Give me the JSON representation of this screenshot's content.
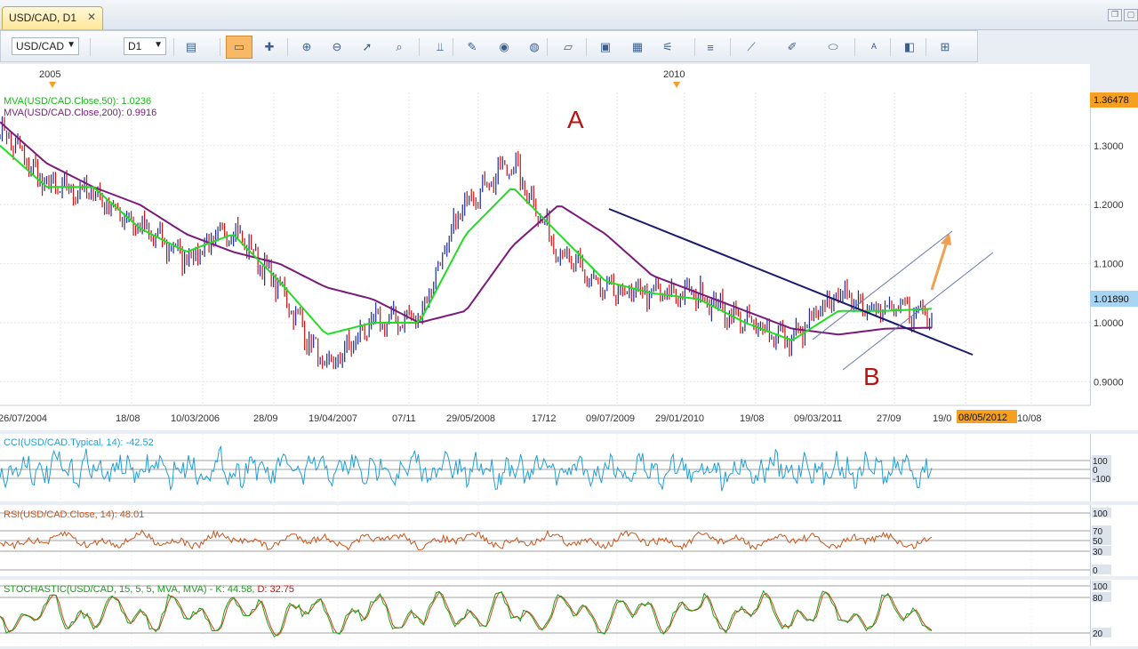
{
  "tab": {
    "title": "USD/CAD, D1",
    "close": "✕"
  },
  "toolbar": {
    "symbol": "USD/CAD",
    "timeframe": "D1",
    "icons": [
      "bar-chart-icon",
      "candle-chart-icon",
      "line-chart-icon",
      "crosshair-icon",
      "zoom-in-icon",
      "zoom-out-icon",
      "pointer-icon",
      "zoom-icon",
      "bar-price-icon",
      "edit-icon",
      "eye-icon",
      "globe-icon",
      "ruler-icon",
      "picture-icon",
      "template-icon",
      "indicators-icon",
      "lines-icon",
      "draw-line-icon",
      "pen-icon",
      "ellipse-icon",
      "text-icon",
      "eraser-icon",
      "structure-icon"
    ]
  },
  "top_axis": {
    "labels": [
      "2005",
      "2010"
    ]
  },
  "main": {
    "legend_ma50": "MVA(USD/CAD.Close,50): 1.0236",
    "legend_ma200": "MVA(USD/CAD.Close,200): 0.9916",
    "label_a": "A",
    "label_b": "B",
    "price_high": "1.36478",
    "price_current": "1.01890",
    "date_badge": "08/05/2012",
    "date_labels": [
      "26/07/2004",
      "18/08",
      "10/03/2006",
      "28/09",
      "19/04/2007",
      "07/11",
      "29/05/2008",
      "17/12",
      "09/07/2009",
      "29/01/2010",
      "19/08",
      "09/03/2011",
      "27/09",
      "19/0",
      "10/08"
    ]
  },
  "chart_data": [
    {
      "type": "line",
      "title": "USD/CAD, D1",
      "x": [
        "2004-07",
        "2005-01",
        "2005-07",
        "2006-01",
        "2006-07",
        "2007-01",
        "2007-07",
        "2007-11",
        "2008-01",
        "2008-07",
        "2008-10",
        "2009-03",
        "2009-07",
        "2009-10",
        "2010-01",
        "2010-07",
        "2011-01",
        "2011-07",
        "2011-10",
        "2012-01",
        "2012-05"
      ],
      "series": [
        {
          "name": "USD/CAD",
          "values": [
            1.33,
            1.23,
            1.22,
            1.16,
            1.11,
            1.16,
            1.06,
            0.92,
            1.0,
            1.01,
            1.21,
            1.27,
            1.12,
            1.05,
            1.05,
            1.05,
            1.0,
            0.97,
            1.05,
            1.02,
            1.02
          ]
        },
        {
          "name": "MVA(USD/CAD.Close,50)",
          "values": [
            1.3,
            1.23,
            1.23,
            1.16,
            1.12,
            1.15,
            1.07,
            0.98,
            1.0,
            1.0,
            1.15,
            1.23,
            1.15,
            1.07,
            1.05,
            1.04,
            1.0,
            0.97,
            1.02,
            1.02,
            1.0236
          ]
        },
        {
          "name": "MVA(USD/CAD.Close,200)",
          "values": [
            1.34,
            1.27,
            1.23,
            1.2,
            1.15,
            1.12,
            1.1,
            1.06,
            1.04,
            1.0,
            1.02,
            1.13,
            1.2,
            1.15,
            1.08,
            1.05,
            1.02,
            0.99,
            0.98,
            0.99,
            0.9916
          ]
        }
      ],
      "ylim": [
        0.86,
        1.39
      ],
      "yticks": [
        0.9,
        1.0,
        1.1,
        1.2,
        1.3
      ],
      "ytick_labels": [
        "0.9000",
        "1.0000",
        "1.1000",
        "1.2000",
        "1.3000"
      ],
      "annotations": [
        "A",
        "B"
      ],
      "grid": true
    },
    {
      "type": "line",
      "title": "CCI(USD/CAD.Typical, 14): -42.52",
      "series": [
        {
          "name": "CCI(USD/CAD.Typical, 14)",
          "last": -42.52
        }
      ],
      "levels": [
        "100",
        "0",
        "-100"
      ]
    },
    {
      "type": "line",
      "title": "RSI(USD/CAD.Close, 14): 48.01",
      "series": [
        {
          "name": "RSI(USD/CAD.Close, 14)",
          "last": 48.01
        }
      ],
      "levels": [
        "100",
        "70",
        "50",
        "30",
        "0"
      ]
    },
    {
      "type": "line",
      "title": "STOCHASTIC(USD/CAD, 15, 5, 5, MVA, MVA) - K: 44.58, D: 32.75",
      "series": [
        {
          "name": "K",
          "last": 44.58
        },
        {
          "name": "D",
          "last": 32.75
        }
      ],
      "levels": [
        "100",
        "80",
        "20"
      ]
    }
  ],
  "colors": {
    "ma50": "#22dd22",
    "ma200": "#7a1a7a",
    "up": "#1a2a9a",
    "down": "#cc1111",
    "cci": "#1e9fd8",
    "rsi": "#c8541a",
    "stoch_k": "#1a9e1a",
    "stoch_d": "#cc4411",
    "trend": "#1a1a6e",
    "arrow": "#f0a050"
  },
  "cci": {
    "title": "CCI(USD/CAD.Typical, 14): -42.52",
    "levels": [
      "100",
      "0",
      "-100"
    ]
  },
  "rsi": {
    "title": "RSI(USD/CAD.Close, 14): 48.01",
    "levels": [
      "100",
      "70",
      "50",
      "30",
      "0"
    ]
  },
  "stoch": {
    "title_pre": "STOCHASTIC(USD/CAD, 15, 5, 5, MVA, MVA) - ",
    "k": "K: 44.58, ",
    "d": "D: 32.75",
    "levels": [
      "100",
      "80",
      "20"
    ]
  }
}
